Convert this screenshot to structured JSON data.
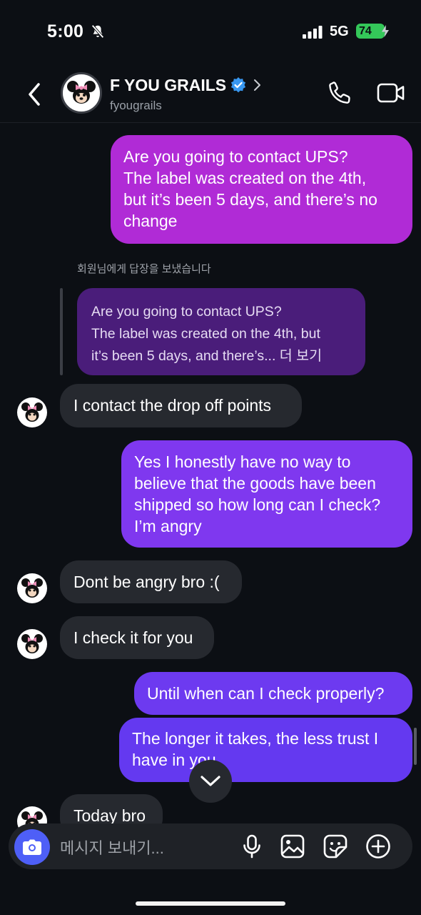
{
  "status_bar": {
    "time": "5:00",
    "network": "5G",
    "battery": "74"
  },
  "header": {
    "name": "F YOU GRAILS",
    "handle": "fyougrails"
  },
  "messages": [
    {
      "id": "m1",
      "lines": [
        "Are you going to contact UPS?",
        "The label was created on the 4th,",
        "but it’s been 5 days, and there’s no",
        "change"
      ]
    },
    {
      "id": "m2",
      "text": "I contact the drop off points"
    },
    {
      "id": "m3",
      "lines": [
        "Yes I honestly have no way to",
        "believe that the goods have been",
        "shipped so how long can I check?",
        "I’m angry"
      ]
    },
    {
      "id": "m4",
      "text": "Dont be angry bro :("
    },
    {
      "id": "m5",
      "text": "I check it for you"
    },
    {
      "id": "m6",
      "text": "Until when can I check properly?"
    },
    {
      "id": "m7",
      "lines": [
        "The longer it takes, the less trust I",
        "have in you"
      ]
    },
    {
      "id": "m8",
      "text": "Today bro"
    }
  ],
  "reply": {
    "label": "회원님에게 답장을 보냈습니다",
    "lines": [
      "Are you going to contact UPS?",
      "The label was created on the 4th, but",
      "it’s been 5 days, and there’s... 더 보기"
    ]
  },
  "composer": {
    "placeholder": "메시지 보내기..."
  },
  "colors": {
    "sent_top": "#b633d9",
    "sent_bottom": "#6a3cf0",
    "accent": "#4e5ff7",
    "verified": "#3897f0"
  },
  "icons": [
    "bell-off-icon",
    "signal-icon",
    "battery-icon",
    "back-icon",
    "verified-icon",
    "chevron-right-icon",
    "phone-icon",
    "video-icon",
    "camera-icon",
    "microphone-icon",
    "gallery-icon",
    "sticker-icon",
    "plus-icon",
    "chevron-down-icon"
  ]
}
